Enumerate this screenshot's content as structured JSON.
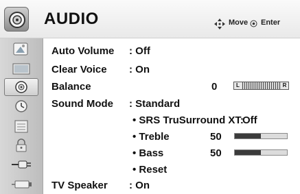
{
  "header": {
    "title": "AUDIO",
    "icon": "speaker-icon",
    "hints": {
      "move_icon": "dpad-arrows-icon",
      "move_label": "Move",
      "enter_icon": "enter-dot-icon",
      "enter_label": "Enter"
    }
  },
  "sidebar": {
    "items": [
      {
        "icon": "picture-icon",
        "selected": false
      },
      {
        "icon": "screen-icon",
        "selected": false
      },
      {
        "icon": "audio-speaker-icon",
        "selected": true
      },
      {
        "icon": "clock-icon",
        "selected": false
      },
      {
        "icon": "options-icon",
        "selected": false
      },
      {
        "icon": "lock-icon",
        "selected": false
      },
      {
        "icon": "input-plug-icon",
        "selected": false
      },
      {
        "icon": "usb-icon",
        "selected": false
      }
    ]
  },
  "menu": {
    "auto_volume": {
      "label": "Auto Volume",
      "value": ": Off"
    },
    "clear_voice": {
      "label": "Clear Voice",
      "value": ": On"
    },
    "balance": {
      "label": "Balance",
      "value": "0",
      "left_mark": "L",
      "right_mark": "R"
    },
    "sound_mode": {
      "label": "Sound Mode",
      "value": ": Standard"
    },
    "srs": {
      "label": "• SRS TruSurround XT:",
      "value": "Off"
    },
    "treble": {
      "label": "• Treble",
      "value": "50",
      "level": 0.5
    },
    "bass": {
      "label": "• Bass",
      "value": "50",
      "level": 0.5
    },
    "reset": {
      "label": "• Reset"
    },
    "tv_speaker": {
      "label": "TV Speaker",
      "value": ": On"
    }
  }
}
